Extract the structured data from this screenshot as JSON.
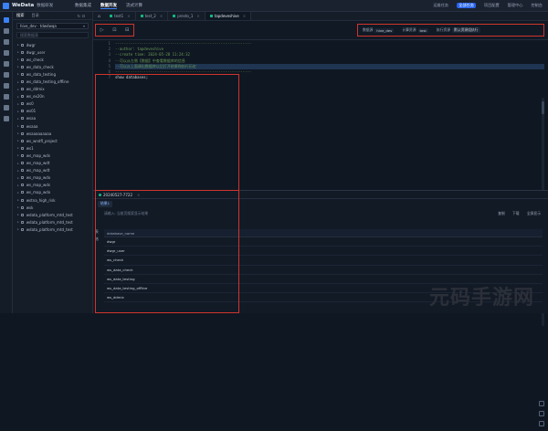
{
  "app": {
    "name": "WeData",
    "subtitle": "数据研发"
  },
  "topnav": [
    "数据集成",
    "数据开发",
    "流式计算"
  ],
  "topnav_active": 1,
  "topright": [
    "运维任务",
    "全部任务",
    "项目配置",
    "管理中心",
    "控制台"
  ],
  "sidebar": {
    "tabs": [
      "搜索",
      "目录"
    ],
    "tab_icons": "↻ ⊡",
    "db_select": "hive_dev · tdwdwqa",
    "search_placeholder": "搜索数据表",
    "tree": [
      "dwgr",
      "dwgr_user",
      "ws_check",
      "ws_data_check",
      "ws_data_testing",
      "ws_data_testing_offline",
      "ws_ddmix",
      "ws_ex20n",
      "ws0",
      "ws01",
      "wsaa",
      "wsaaa",
      "wsaaaaaaaaa",
      "ws_wndfl_project",
      "ws1",
      "ws_map_wds",
      "ws_map_wdt",
      "ws_map_wdt",
      "ws_map_wdx",
      "ws_map_wds",
      "ws_map_wdx",
      "wstna_high_risk",
      "wsk",
      "wdata_platform_mtd_test",
      "wdata_platform_mtd_test",
      "wdata_platform_mtd_test"
    ]
  },
  "tabs": [
    {
      "label": "test1",
      "active": false
    },
    {
      "label": "test_2",
      "active": false
    },
    {
      "label": "presto_1",
      "active": false
    },
    {
      "label": "tapdeveshive",
      "active": true
    }
  ],
  "toolbar": {
    "buttons": [
      "▷",
      "⊡",
      "⊟"
    ],
    "right": [
      {
        "label": "数据源",
        "value": "hive_dev"
      },
      {
        "label": "计算资源",
        "value": "test"
      },
      {
        "label": "执行资源",
        "value": "默认资源组执行"
      }
    ]
  },
  "editor": {
    "line_numbers": [
      "1",
      "2",
      "3",
      "4",
      "5",
      "6",
      "7"
    ],
    "lines": [
      "--------------------------------------------------------------",
      "--author: tapdeveshive",
      "--create time: 2024-05-28 11:24:32",
      "--可以从左侧【数据】中查看数据库的信息",
      "--可以从上面调出数据库以后打开结果和执行历史",
      "--------------------------------------------------------------",
      "show databases;"
    ]
  },
  "results": {
    "tab_label": "20240527-7722",
    "chip": "结果1",
    "search_placeholder": "请输入: 当前页搜索显示结果",
    "tools": [
      "复制",
      "下载",
      "全屏显示"
    ],
    "column": "database_name",
    "row_tool_labels": [
      "表",
      "格"
    ],
    "rows": [
      "dwgr",
      "dwgr_user",
      "ws_check",
      "ws_data_check",
      "ws_data_testing",
      "ws_data_testing_offline",
      "ws_ddmix"
    ]
  },
  "watermark": "元码手游网",
  "colors": {
    "accent": "#3b82f6",
    "highlight_box": "#d0342c",
    "comment": "#6a9955"
  }
}
